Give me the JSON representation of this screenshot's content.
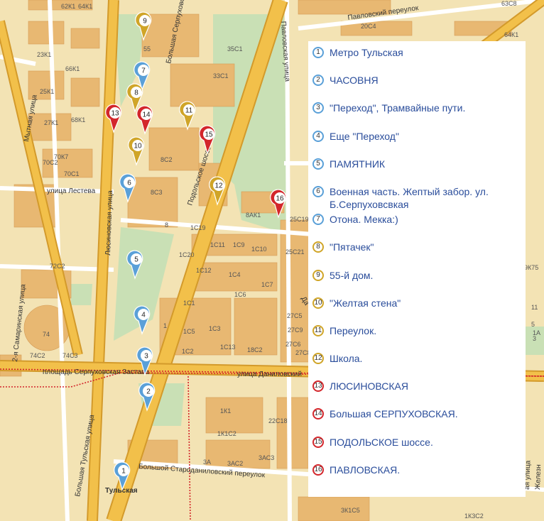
{
  "map": {
    "streets": {
      "mytnaya": "Мытная улица",
      "lyusinovskaya": "Люсиновская улица",
      "samarinskaya": "2-я Самаринская улица",
      "lesteva": "улица Лестева",
      "podolskoe": "Подольское шоссе",
      "pavlovskaya": "Павловская улица",
      "pavlovsky_per": "Павловский переулок",
      "serpuhovskaya_pl": "площадь Серпуховская Застава",
      "danilovsky": "улица Даниловский",
      "bolshaya_tulskaya": "Большая Тульская улица",
      "starodanilovsky": "Большой Староданиловский переулок",
      "zh_ul": "ая улица",
      "zhelez": "Железн",
      "b_serp": "Большая Серпуховская улица",
      "da": "Да"
    },
    "metro_label": "Тульская",
    "house_labels": [
      "62К1",
      "64К1",
      "23К1",
      "66К1",
      "25К1",
      "27К1",
      "68К1",
      "70К7",
      "70С2",
      "70С1",
      "72С2",
      "74",
      "74С2",
      "74С3",
      "55",
      "35С1",
      "33С1",
      "8С2",
      "8С3",
      "8",
      "8АК1",
      "1С19",
      "1С11",
      "1С9",
      "1С10",
      "1С20",
      "1С12",
      "1С4",
      "1С7",
      "1С6",
      "1С13",
      "1С1",
      "1С5",
      "1С3",
      "1С2",
      "18С2",
      "1",
      "25С19",
      "25С21",
      "27С9",
      "27С6",
      "27С8",
      "27С5",
      "1К1",
      "1К1С2",
      "3АС3",
      "3А",
      "3АС2",
      "22С18",
      "63С8",
      "64К1",
      "20С4",
      "1К3С2",
      "3К1С5",
      "9К75",
      "11",
      "5",
      "1А",
      "3"
    ]
  },
  "markers": [
    {
      "num": "1",
      "color": "blue"
    },
    {
      "num": "2",
      "color": "blue"
    },
    {
      "num": "3",
      "color": "blue"
    },
    {
      "num": "4",
      "color": "blue"
    },
    {
      "num": "5",
      "color": "blue"
    },
    {
      "num": "6",
      "color": "blue"
    },
    {
      "num": "7",
      "color": "blue"
    },
    {
      "num": "8",
      "color": "yellow"
    },
    {
      "num": "9",
      "color": "yellow"
    },
    {
      "num": "10",
      "color": "yellow"
    },
    {
      "num": "11",
      "color": "yellow"
    },
    {
      "num": "12",
      "color": "yellow"
    },
    {
      "num": "13",
      "color": "red"
    },
    {
      "num": "14",
      "color": "red"
    },
    {
      "num": "15",
      "color": "red"
    },
    {
      "num": "16",
      "color": "red"
    }
  ],
  "legend": [
    {
      "num": "1",
      "label": "Метро Тульская",
      "color": "blue"
    },
    {
      "num": "2",
      "label": "ЧАСОВНЯ",
      "color": "blue"
    },
    {
      "num": "3",
      "label": "\"Переход\", Трамвайные пути.",
      "color": "blue"
    },
    {
      "num": "4",
      "label": "Еще \"Переход\"",
      "color": "blue"
    },
    {
      "num": "5",
      "label": "ПАМЯТНИК",
      "color": "blue"
    },
    {
      "num": "6",
      "label": "Военная часть. Жептый забор. ул. Б.Серпуховсвкая",
      "color": "blue"
    },
    {
      "num": "7",
      "label": "Отона. Мекка:)",
      "color": "blue"
    },
    {
      "num": "8",
      "label": "\"Пятачек\"",
      "color": "yellow"
    },
    {
      "num": "9",
      "label": "55-й дом.",
      "color": "yellow"
    },
    {
      "num": "10",
      "label": "\"Желтая стена\"",
      "color": "yellow"
    },
    {
      "num": "11",
      "label": "Переулок.",
      "color": "yellow"
    },
    {
      "num": "12",
      "label": "Школа.",
      "color": "yellow"
    },
    {
      "num": "13",
      "label": "ЛЮСИНОВСКАЯ",
      "color": "red"
    },
    {
      "num": "14",
      "label": "Большая СЕРПУХОВСКАЯ.",
      "color": "red"
    },
    {
      "num": "15",
      "label": "ПОДОЛЬСКОЕ шоссе.",
      "color": "red"
    },
    {
      "num": "16",
      "label": "ПАВЛОВСКАЯ.",
      "color": "red"
    }
  ],
  "colors": {
    "blue": "#5aa0d8",
    "yellow": "#d0a528",
    "red": "#d3262b",
    "road": "#f2c04a",
    "road_edge": "#d39a2b",
    "park": "#c9e0b5",
    "building": "#e8b872",
    "ground": "#f3e3b4"
  }
}
